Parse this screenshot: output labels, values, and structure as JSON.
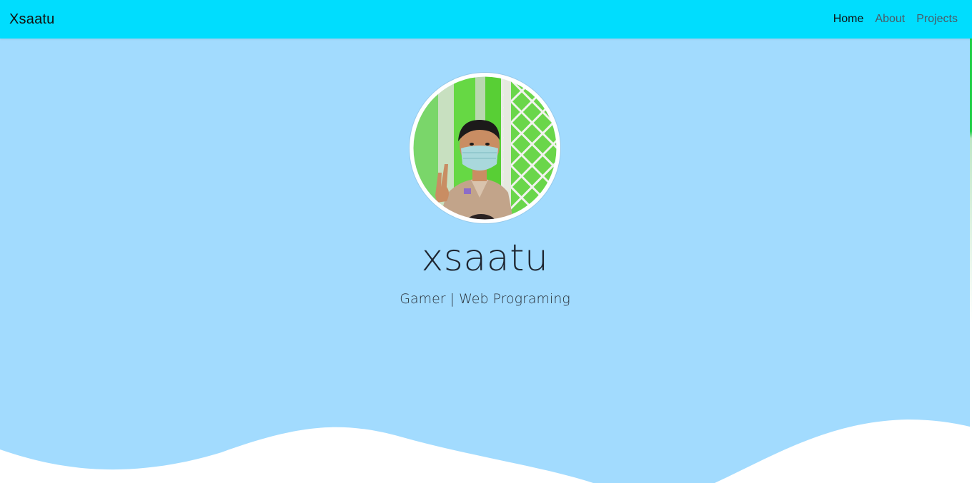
{
  "navbar": {
    "brand": "Xsaatu",
    "links": [
      {
        "label": "Home",
        "active": true
      },
      {
        "label": "About",
        "active": false
      },
      {
        "label": "Projects",
        "active": false
      }
    ]
  },
  "hero": {
    "name": "xsaatu",
    "tagline": "Gamer | Web Programing",
    "avatar_icon": "profile-photo"
  },
  "colors": {
    "navbar_bg": "#00ddfe",
    "hero_bg": "#a2dbfe",
    "wave": "#ffffff",
    "accent_edge": "#22d04a"
  }
}
